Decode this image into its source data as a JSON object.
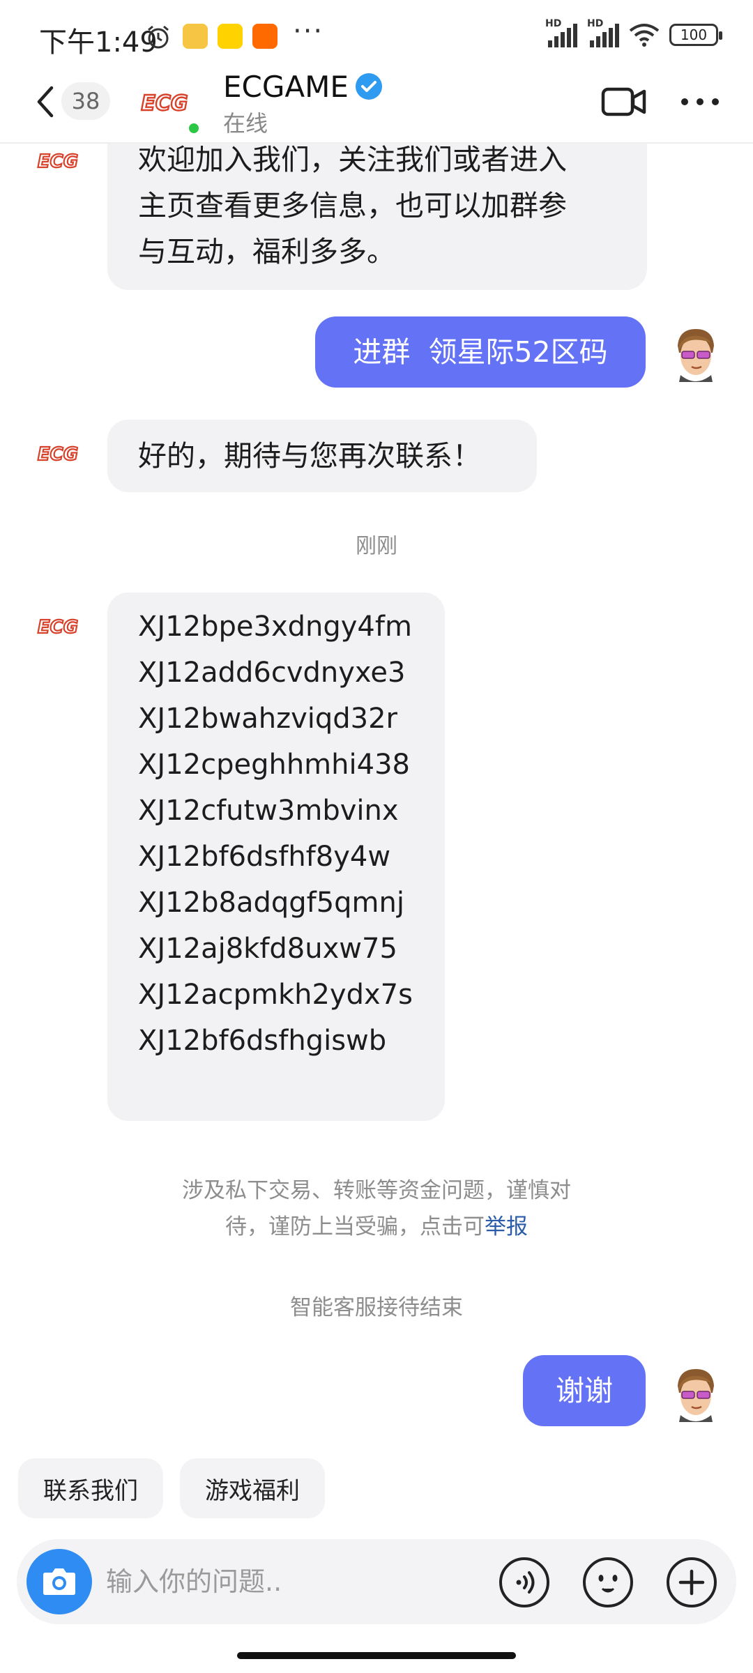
{
  "status_bar": {
    "time": "下午1:49",
    "battery": "100",
    "network_1": "HD",
    "network_2": "HD",
    "icons": [
      "alarm-icon",
      "app-icon-duck",
      "app-icon-meituan",
      "app-icon-mi",
      "more-dots",
      "signal-icon",
      "wifi-icon",
      "battery-icon"
    ]
  },
  "header": {
    "unread_count": "38",
    "contact_name": "ECGAME",
    "status": "在线",
    "avatar_label": "ECG",
    "verified": true
  },
  "messages": [
    {
      "from": "bot",
      "text_lines": [
        "欢迎加入我们，关注我们或者进入",
        "主页查看更多信息，也可以加群参",
        "与互动，福利多多。"
      ]
    },
    {
      "from": "user",
      "text": "进群  领星际52区码"
    },
    {
      "from": "bot",
      "text": "好的，期待与您再次联系！"
    },
    {
      "type": "timestamp",
      "text": "刚刚"
    },
    {
      "from": "bot",
      "codes": [
        "XJ12bpe3xdngy4fm",
        "XJ12add6cvdnyxe3",
        "XJ12bwahzviqd32r",
        "XJ12cpeghhmhi438",
        "XJ12cfutw3mbvinx",
        "XJ12bf6dsfhf8y4w",
        "XJ12b8adqgf5qmnj",
        "XJ12aj8kfd8uxw75",
        "XJ12acpmkh2ydx7s",
        "XJ12bf6dsfhgiswb"
      ]
    },
    {
      "type": "notice",
      "line1": "涉及私下交易、转账等资金问题，谨慎对",
      "line2_prefix": "待，谨防上当受骗，点击可",
      "link": "举报"
    },
    {
      "type": "system",
      "text": "智能客服接待结束"
    },
    {
      "from": "user",
      "text": "谢谢"
    }
  ],
  "quick_replies": [
    "联系我们",
    "游戏福利"
  ],
  "input": {
    "placeholder": "输入你的问题.."
  },
  "colors": {
    "user_bubble": "#6472f6",
    "bot_bubble": "#f2f2f4",
    "brand_red": "#d8412a",
    "camera_button": "#2f8cf2",
    "online": "#2ac845",
    "verified": "#2f9bf0"
  }
}
